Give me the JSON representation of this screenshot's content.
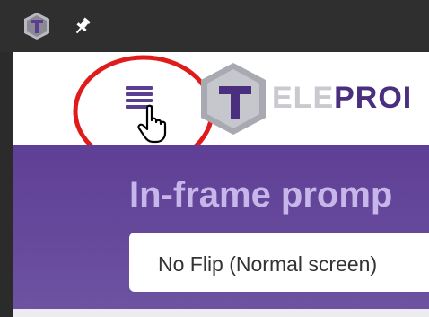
{
  "brand": {
    "text_light": "ELE",
    "text_dark": "PROI"
  },
  "hero": {
    "title": "In-frame promp"
  },
  "flip_select": {
    "selected": "No Flip (Normal screen)"
  },
  "icons": [
    "app-logo-icon",
    "pin-icon",
    "hamburger-menu-icon",
    "hand-cursor-icon",
    "brand-logo-icon"
  ],
  "colors": {
    "accent": "#5e3f95",
    "highlight_circle": "#e01b1b"
  }
}
